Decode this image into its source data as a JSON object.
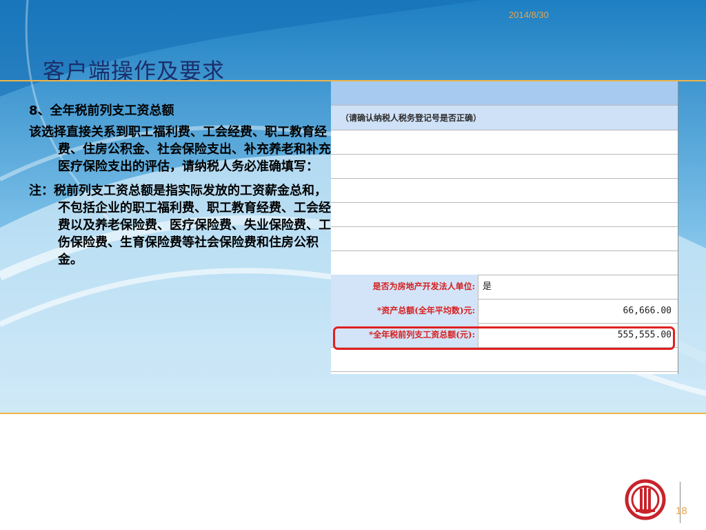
{
  "slide": {
    "date": "2014/8/30",
    "title": "客户端操作及要求",
    "page_number": "18"
  },
  "content": {
    "heading": "8、全年税前列支工资总额",
    "paragraph1": "该选择直接关系到职工福利费、工会经费、职工教育经费、住房公积金、社会保险支出、补充养老和补充医疗保险支出的评估，请纳税人务必准确填写：",
    "paragraph2": "注：税前列支工资总额是指实际发放的工资薪金总和，不包括企业的职工福利费、职工教育经费、工会经费以及养老保险费、医疗保险费、失业保险费、工伤保险费、生育保险费等社会保险费和住房公积金。"
  },
  "form": {
    "hint": "（请确认纳税人税务登记号是否正确）",
    "rows": [
      {
        "label": "是否为房地产开发法人单位:",
        "value": "是"
      },
      {
        "label": "*资产总额(全年平均数)元:",
        "value": "66,666.00"
      },
      {
        "label": "*全年税前列支工资总额(元):",
        "value": "555,555.00"
      }
    ]
  },
  "colors": {
    "title": "#1b2f6b",
    "accent_rule": "#f0b446",
    "highlight_border": "#e02020",
    "label_text": "#d61e1e",
    "form_header": "#a7caf0"
  }
}
